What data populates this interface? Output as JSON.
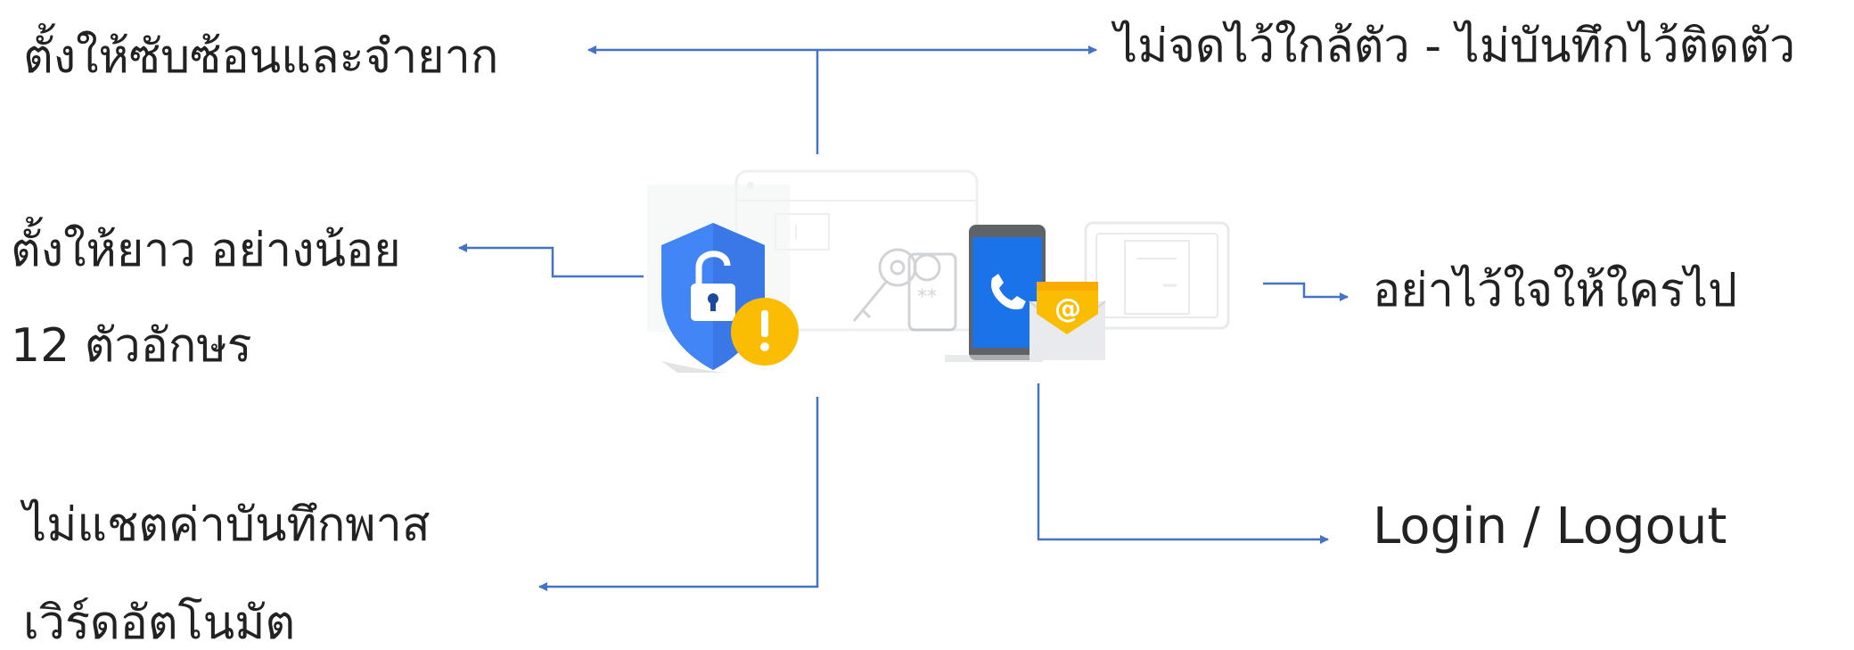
{
  "labels": {
    "top_left": "ตั้งให้ซับซ้อนและจำยาก",
    "top_right": "ไม่จดไว้ใกล้ตัว - ไม่บันทึกไว้ติดตัว",
    "mid_left_line1": "ตั้งให้ยาว อย่างน้อย",
    "mid_left_line2": "12 ตัวอักษร",
    "mid_right": "อย่าไว้ใจให้ใครไป",
    "bottom_left_line1": "ไม่แชตค่าบันทึกพาส",
    "bottom_left_line2": "เวิร์ดอัตโนมัต",
    "bottom_right": "Login / Logout"
  },
  "colors": {
    "connector": "#4472c4",
    "shield": "#4285f4",
    "warning": "#fbbc04",
    "phone": "#1a73e8",
    "envelope": "#f9ab00"
  },
  "icons": [
    "security-shield-lock-icon",
    "warning-icon",
    "key-icon",
    "phone-icon",
    "email-icon",
    "browser-window-icon",
    "document-window-icon"
  ]
}
